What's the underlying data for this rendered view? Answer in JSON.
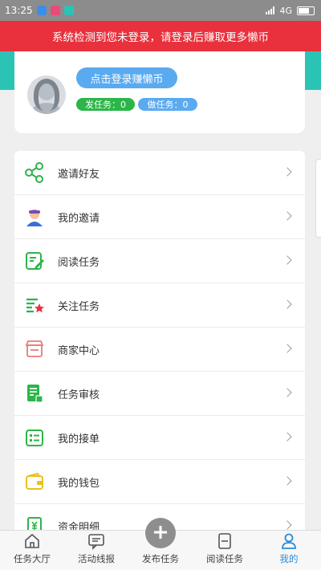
{
  "status_bar": {
    "time": "13:25",
    "network": "4G"
  },
  "alert": {
    "text": "系统检测到您未登录，请登录后赚取更多懒币"
  },
  "profile": {
    "login_button": "点击登录赚懒币",
    "publish_tasks": "发任务：0",
    "micro_tasks": "做任务：0"
  },
  "menu": {
    "items": [
      {
        "label": "邀请好友",
        "icon": "share-icon",
        "color": "#2cb548"
      },
      {
        "label": "我的邀请",
        "icon": "person-icon",
        "color": "#6a5acd"
      },
      {
        "label": "阅读任务",
        "icon": "edit-doc-icon",
        "color": "#2cb548"
      },
      {
        "label": "关注任务",
        "icon": "list-star-icon",
        "color": "#2cb548"
      },
      {
        "label": "商家中心",
        "icon": "store-icon",
        "color": "#e8313c"
      },
      {
        "label": "任务审核",
        "icon": "doc-review-icon",
        "color": "#2cb548"
      },
      {
        "label": "我的接单",
        "icon": "order-list-icon",
        "color": "#2cb548"
      },
      {
        "label": "我的钱包",
        "icon": "wallet-icon",
        "color": "#e8c020"
      },
      {
        "label": "资金明细",
        "icon": "money-doc-icon",
        "color": "#2cb548"
      }
    ]
  },
  "tabbar": {
    "tabs": [
      {
        "label": "任务大厅",
        "icon": "home-icon"
      },
      {
        "label": "活动线报",
        "icon": "message-icon"
      },
      {
        "label": "发布任务",
        "icon": "plus-icon"
      },
      {
        "label": "阅读任务",
        "icon": "read-icon"
      },
      {
        "label": "我的",
        "icon": "user-icon",
        "active": true
      }
    ]
  }
}
